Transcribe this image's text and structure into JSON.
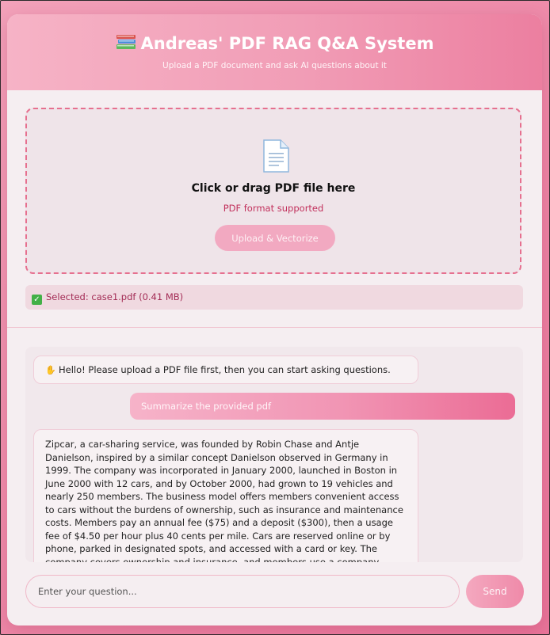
{
  "header": {
    "title": "Andreas' PDF RAG Q&A System",
    "subtitle": "Upload a PDF document and ask AI questions about it",
    "icon": "books-icon"
  },
  "upload": {
    "icon": "file-icon",
    "title": "Click or drag PDF file here",
    "subtitle": "PDF format supported",
    "button_label": "Upload & Vectorize"
  },
  "selected_file": {
    "text": "Selected: case1.pdf (0.41 MB)",
    "icon": "check-icon"
  },
  "chat": {
    "messages": [
      {
        "role": "assistant",
        "icon": "wave-icon",
        "text": "Hello! Please upload a PDF file first, then you can start asking questions."
      },
      {
        "role": "user",
        "text": "Summarize the provided pdf"
      },
      {
        "role": "assistant",
        "text": "Zipcar, a car-sharing service, was founded by Robin Chase and Antje Danielson, inspired by a similar concept Danielson observed in Germany in 1999. The company was incorporated in January 2000, launched in Boston in June 2000 with 12 cars, and by October 2000, had grown to 19 vehicles and nearly 250 members. The business model offers members convenient access to cars without the burdens of ownership, such as insurance and maintenance costs. Members pay an annual fee ($75) and a deposit ($300), then a usage fee of $4.50 per hour plus 40 cents per mile. Cars are reserved online or by phone, parked in designated spots, and accessed with a card or key. The company covers ownership and insurance, and members use a company credit card for gas. Late"
      }
    ]
  },
  "input": {
    "placeholder": "Enter your question...",
    "value": "",
    "send_label": "Send"
  },
  "colors": {
    "accent": "#ec7fa0",
    "accent_text": "#c2305c",
    "success": "#43b047"
  }
}
